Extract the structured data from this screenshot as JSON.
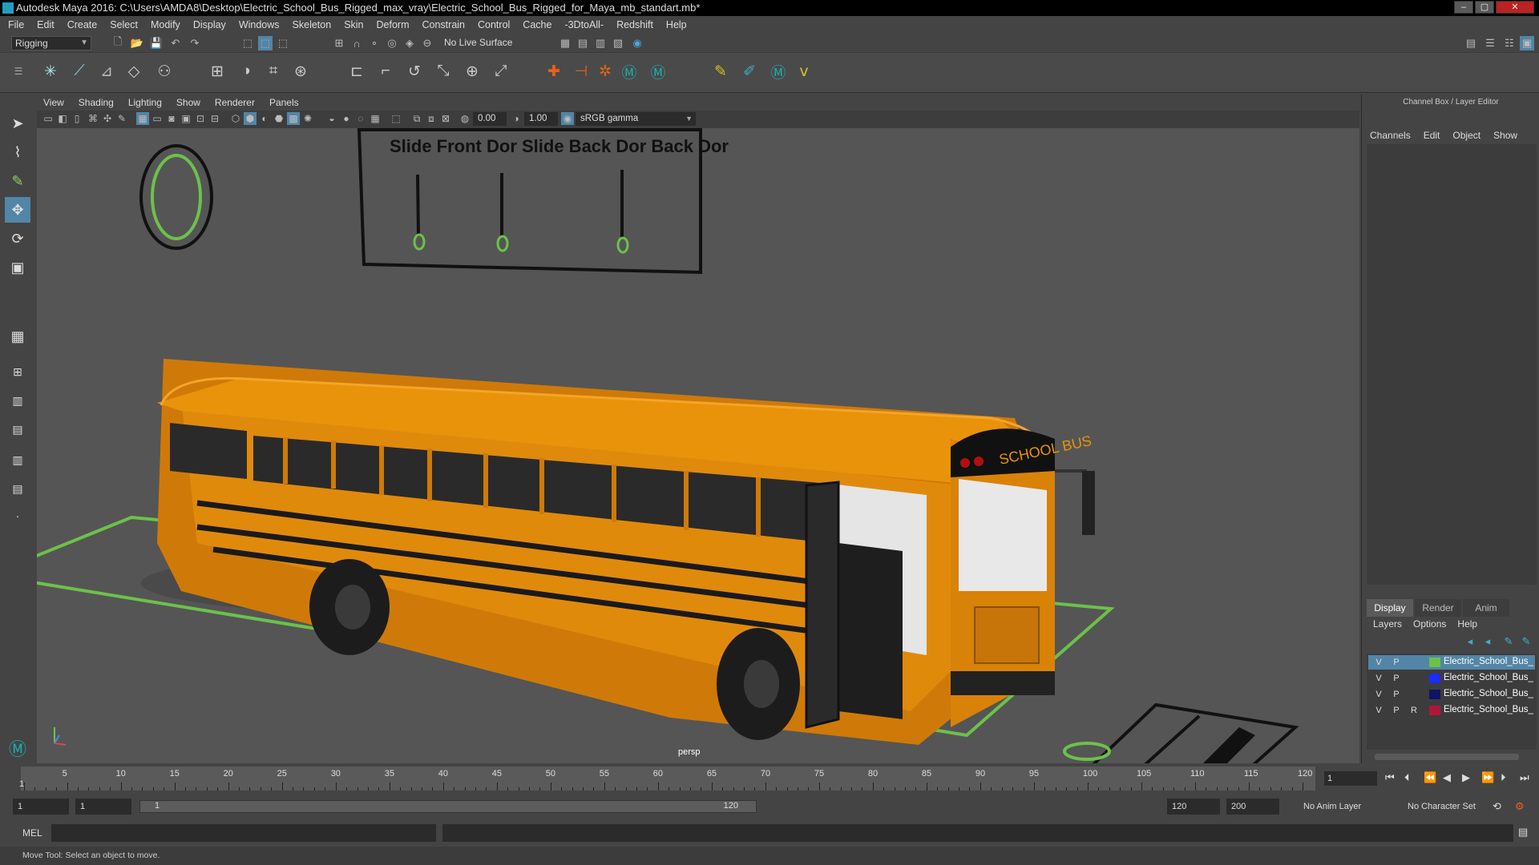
{
  "app": {
    "title": "Autodesk Maya 2016: C:\\Users\\AMDA8\\Desktop\\Electric_School_Bus_Rigged_max_vray\\Electric_School_Bus_Rigged_for_Maya_mb_standart.mb*"
  },
  "menubar": [
    "File",
    "Edit",
    "Create",
    "Select",
    "Modify",
    "Display",
    "Windows",
    "Skeleton",
    "Skin",
    "Deform",
    "Constrain",
    "Control",
    "Cache",
    "-3DtoAll-",
    "Redshift",
    "Help"
  ],
  "shelf": {
    "mode": "Rigging",
    "live_surface": "No Live Surface"
  },
  "viewport": {
    "menu": [
      "View",
      "Shading",
      "Lighting",
      "Show",
      "Renderer",
      "Panels"
    ],
    "exposure": "0.00",
    "gamma": "1.00",
    "colorspace": "sRGB gamma",
    "camera": "persp",
    "controls_label_top": "Slide Front Dor  Slide Back Dor  Back Dor",
    "bus_sign": "SCHOOL BUS"
  },
  "channel_box": {
    "title": "Channel Box / Layer Editor",
    "menu": [
      "Channels",
      "Edit",
      "Object",
      "Show"
    ]
  },
  "layer_editor": {
    "tabs": [
      "Display",
      "Render",
      "Anim"
    ],
    "menu": [
      "Layers",
      "Options",
      "Help"
    ],
    "layers": [
      {
        "v": "V",
        "p": "P",
        "r": "",
        "color": "#6cc14a",
        "name": "Electric_School_Bus_Ri",
        "selected": true
      },
      {
        "v": "V",
        "p": "P",
        "r": "",
        "color": "#1a2cff",
        "name": "Electric_School_Bus_Ri",
        "selected": false
      },
      {
        "v": "V",
        "p": "P",
        "r": "",
        "color": "#121266",
        "name": "Electric_School_Bus_Ri",
        "selected": false
      },
      {
        "v": "V",
        "p": "P",
        "r": "R",
        "color": "#b0163a",
        "name": "Electric_School_Bus_Ri",
        "selected": false
      }
    ]
  },
  "timeline": {
    "ticks": [
      "1",
      "5",
      "10",
      "15",
      "20",
      "25",
      "30",
      "35",
      "40",
      "45",
      "50",
      "55",
      "60",
      "65",
      "70",
      "75",
      "80",
      "85",
      "90",
      "95",
      "100",
      "105",
      "110",
      "115",
      "120"
    ],
    "current_frame": "1"
  },
  "range": {
    "start": "1",
    "playback_start": "1",
    "slider_start": "1",
    "slider_end": "120",
    "playback_end": "120",
    "end": "200",
    "anim_layer": "No Anim Layer",
    "char_set": "No Character Set"
  },
  "mel": {
    "label": "MEL"
  },
  "status": {
    "text": "Move Tool: Select an object to move."
  },
  "colors": {
    "rig_green": "#6cc14a",
    "bus_yellow": "#e8930a"
  }
}
